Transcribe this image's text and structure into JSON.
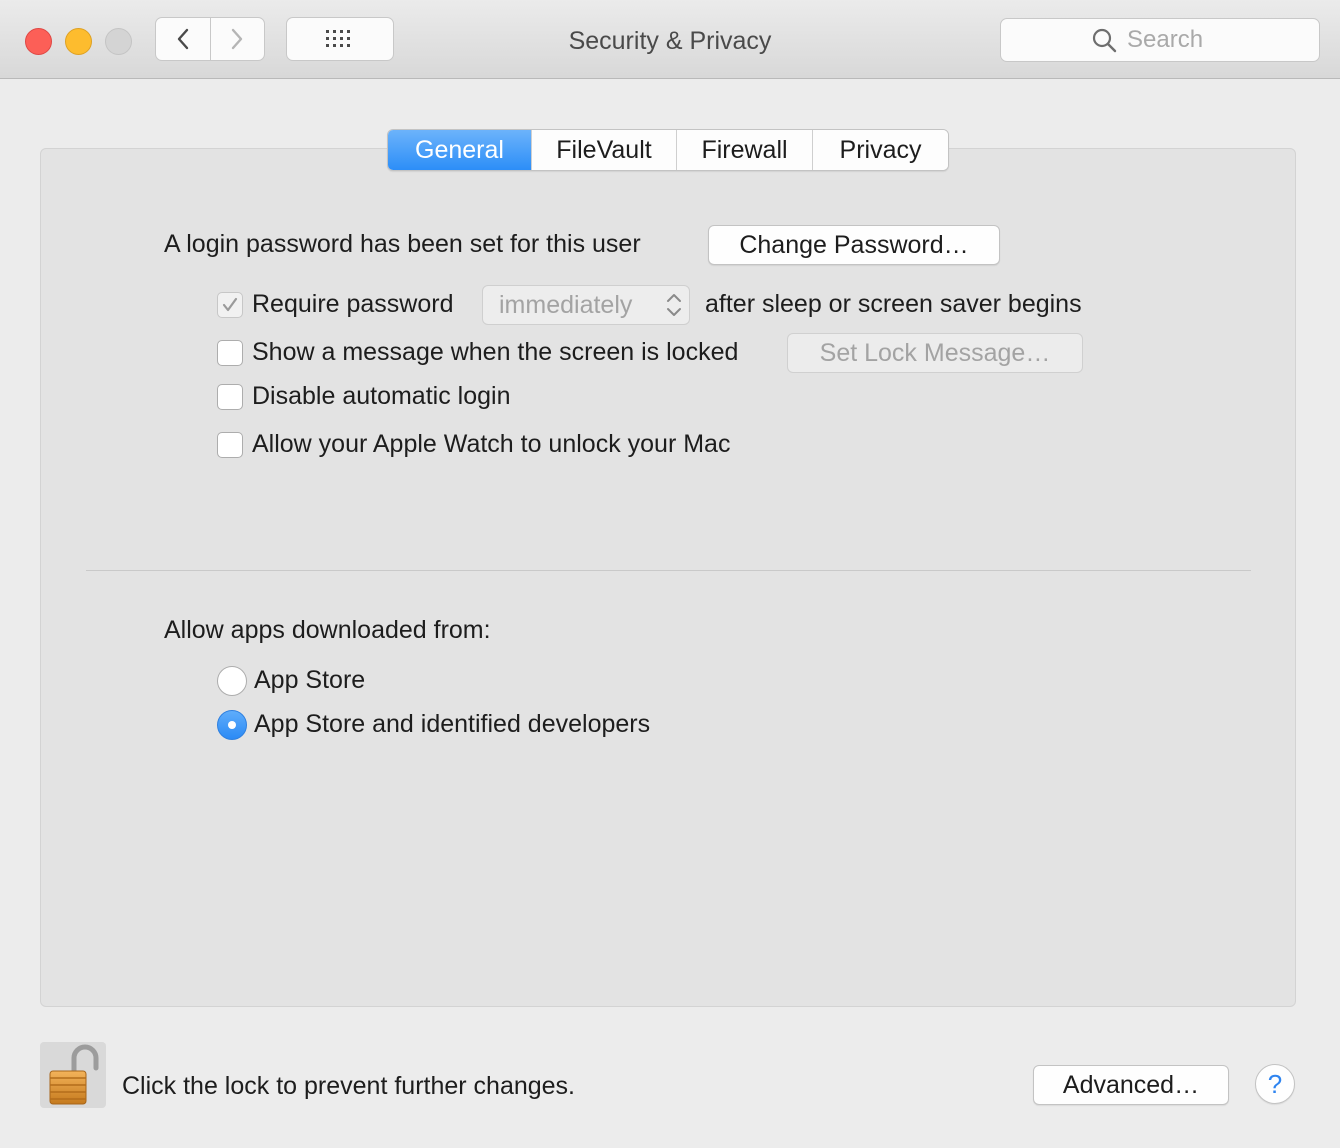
{
  "window": {
    "title": "Security & Privacy"
  },
  "search": {
    "placeholder": "Search"
  },
  "tabs": [
    {
      "label": "General",
      "selected": true
    },
    {
      "label": "FileVault",
      "selected": false
    },
    {
      "label": "Firewall",
      "selected": false
    },
    {
      "label": "Privacy",
      "selected": false
    }
  ],
  "general": {
    "password_label": "A login password has been set for this user",
    "change_password_button": "Change Password…",
    "require_password": {
      "label": "Require password",
      "checked": true,
      "disabled": true
    },
    "require_interval": "immediately",
    "after_sleep_label": "after sleep or screen saver begins",
    "show_message": {
      "label": "Show a message when the screen is locked",
      "checked": false
    },
    "set_lock_message_button": "Set Lock Message…",
    "disable_auto_login": {
      "label": "Disable automatic login",
      "checked": false
    },
    "apple_watch": {
      "label": "Allow your Apple Watch to unlock your Mac",
      "checked": false
    },
    "allow_apps_label": "Allow apps downloaded from:",
    "radio_options": [
      {
        "label": "App Store",
        "selected": false
      },
      {
        "label": "App Store and identified developers",
        "selected": true
      }
    ]
  },
  "footer": {
    "lock_text": "Click the lock to prevent further changes.",
    "advanced_button": "Advanced…",
    "help_glyph": "?"
  },
  "icons": {
    "back": "chevron-left-icon",
    "forward": "chevron-right-icon",
    "show_all": "grid-icon",
    "search": "search-icon",
    "lock": "lock-open-icon",
    "checkmark": "checkmark-icon",
    "popup_arrows": "up-down-arrows-icon"
  },
  "colors": {
    "accent": "#2c8ef8",
    "close": "#fc5f57",
    "minimize": "#fdbc2e",
    "zoom_disabled": "#d4d4d4"
  }
}
